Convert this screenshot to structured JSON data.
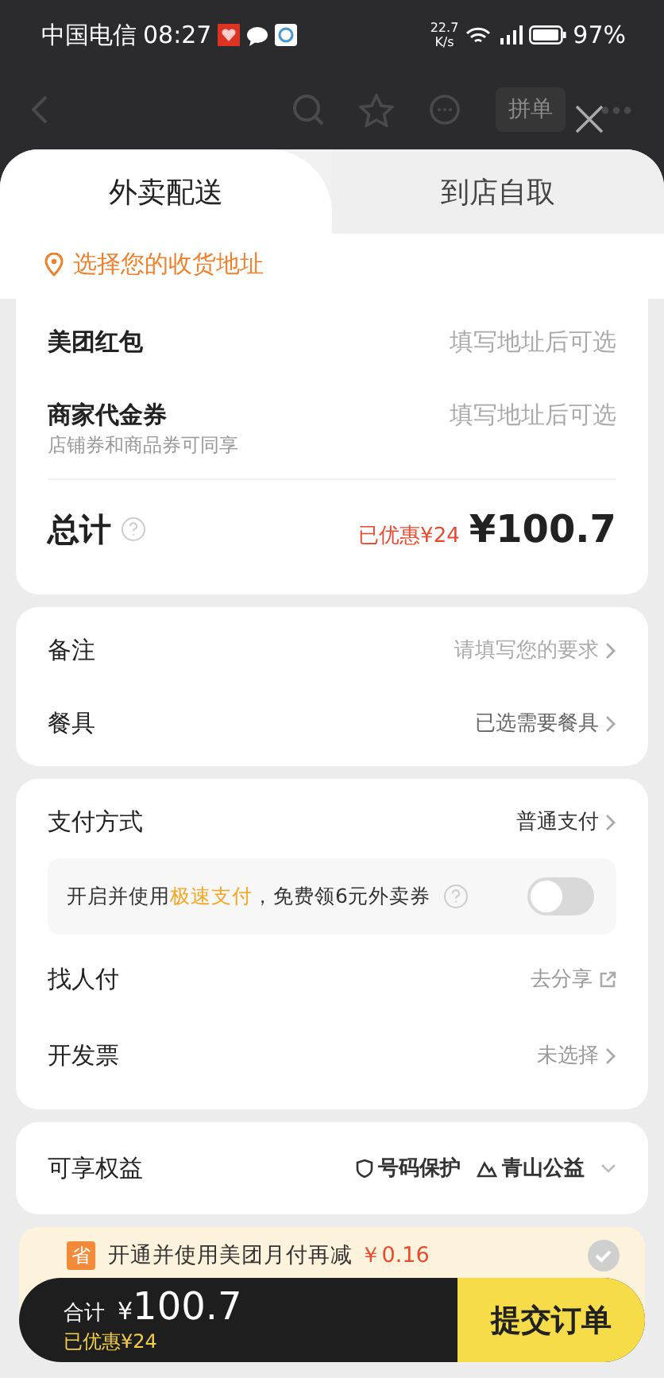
{
  "status_bar": {
    "carrier": "中国电信",
    "time": "08:27",
    "speed": [
      "22.7",
      "K/s"
    ],
    "battery": "97%"
  },
  "header": {
    "group_order": "拼单"
  },
  "tabs": [
    {
      "label": "外卖配送",
      "selected": true
    },
    {
      "label": "到店自取",
      "selected": false
    }
  ],
  "address": "选择您的收货地址",
  "discounts": [
    {
      "label": "美团红包",
      "value": "填写地址后可选"
    },
    {
      "label": "商家代金券",
      "sub": "店铺券和商品券可同享",
      "value": "填写地址后可选"
    }
  ],
  "total": {
    "label": "总计",
    "saved": "已优惠¥24",
    "currency": "¥",
    "amount": "100.7"
  },
  "notes": [
    {
      "label": "备注",
      "value": "请填写您的要求",
      "placeholder": true
    },
    {
      "label": "餐具",
      "value": "已选需要餐具",
      "placeholder": false
    }
  ],
  "payment": {
    "label": "支付方式",
    "value": "普通支付",
    "fast_pay": {
      "text": "开启并使用**极速支付**，免费领6元外卖券",
      "on": false
    },
    "rows": [
      {
        "label": "找人付",
        "value": "去分享",
        "kind": "share"
      },
      {
        "label": "开发票",
        "value": "未选择",
        "kind": "chevron"
      }
    ]
  },
  "benefits": {
    "label": "可享权益",
    "items": [
      {
        "label": "号码保护",
        "kind": "shield"
      },
      {
        "label": "青山公益",
        "kind": "mountain"
      }
    ]
  },
  "promo": {
    "badge": "省",
    "text": "开通并使用美团月付再减",
    "amount": "￥0.16",
    "checked": false
  },
  "checkout": {
    "label": "合计",
    "currency": "¥",
    "amount": "100.7",
    "saved": "已优惠¥24",
    "button": "提交订单"
  }
}
